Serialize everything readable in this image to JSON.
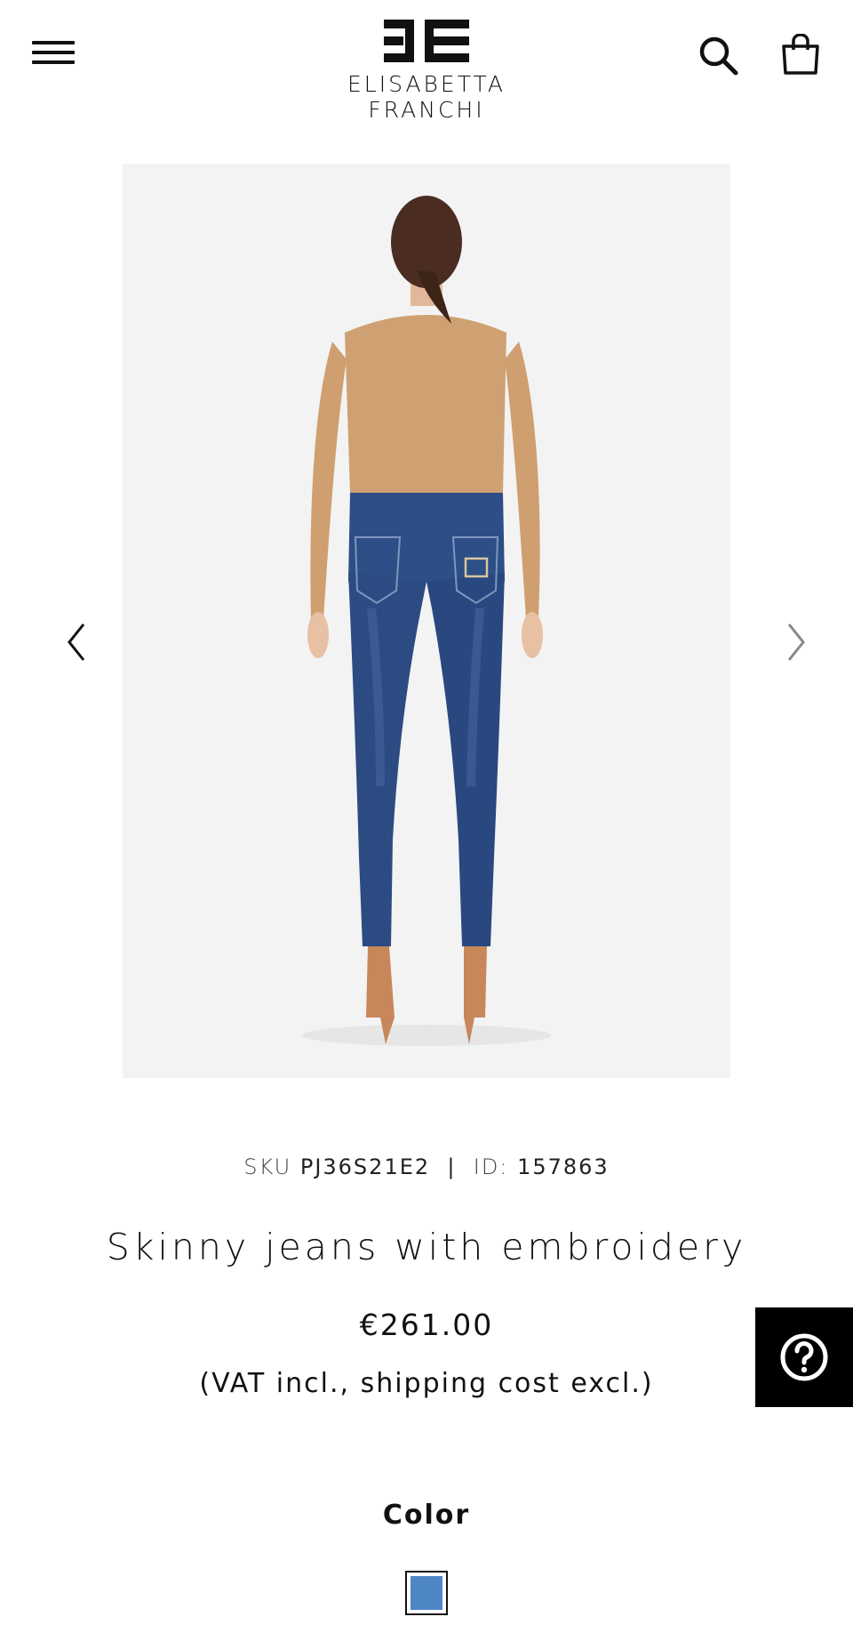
{
  "header": {
    "brand_name": "ELISABETTA FRANCHI",
    "menu_icon": "hamburger-menu-icon",
    "search_icon": "search-icon",
    "bag_icon": "shopping-bag-icon"
  },
  "gallery": {
    "image_alt": "Skinny jeans with embroidery",
    "prev_icon": "chevron-left-icon",
    "next_icon": "chevron-right-icon",
    "background_color": "#f3f3f3"
  },
  "product": {
    "sku_label": "SKU",
    "sku_value": "PJ36S21E2",
    "separator": "|",
    "id_label": "ID:",
    "id_value": "157863",
    "title": "Skinny jeans with embroidery",
    "price": "€261.00",
    "vat_note": "(VAT incl., shipping cost excl.)"
  },
  "help": {
    "icon": "help-circle-icon"
  },
  "color": {
    "label": "Color",
    "selected_swatch": "#4f86c6"
  }
}
